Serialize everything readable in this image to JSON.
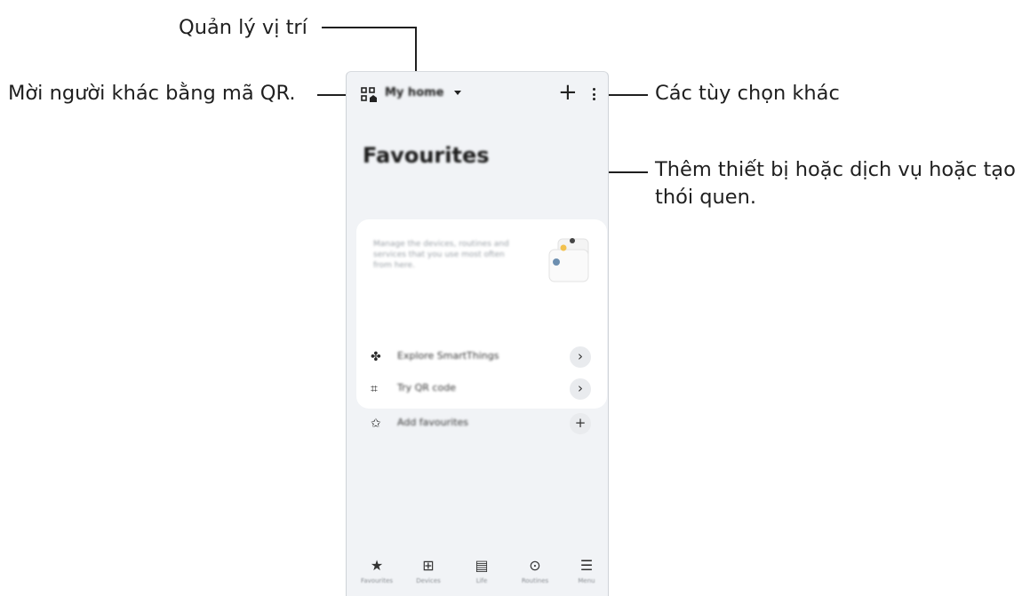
{
  "callouts": {
    "location": "Quản lý vị trí",
    "qr_invite": "Mời người khác bằng mã QR.",
    "more_options": "Các tùy chọn khác",
    "add_line1": "Thêm thiết bị hoặc dịch vụ hoặc tạo",
    "add_line2": "thói quen."
  },
  "app": {
    "location_name": "My home",
    "add_symbol": "+",
    "title": "Favourites",
    "card_text": "Manage the devices, routines and services that you use most often from here.",
    "rows": [
      {
        "icon": "smartthings-icon",
        "glyph": "✤",
        "label": "Explore SmartThings",
        "action": "›"
      },
      {
        "icon": "qr-code-icon",
        "glyph": "⌗",
        "label": "Try QR code",
        "action": "›"
      },
      {
        "icon": "star-icon",
        "glyph": "✩",
        "label": "Add favourites",
        "action": "+"
      }
    ],
    "nav": [
      {
        "icon": "star-icon",
        "glyph": "★",
        "label": "Favourites"
      },
      {
        "icon": "devices-icon",
        "glyph": "⊞",
        "label": "Devices"
      },
      {
        "icon": "life-icon",
        "glyph": "▤",
        "label": "Life"
      },
      {
        "icon": "routines-icon",
        "glyph": "⊙",
        "label": "Routines"
      },
      {
        "icon": "menu-icon",
        "glyph": "☰",
        "label": "Menu"
      }
    ]
  }
}
